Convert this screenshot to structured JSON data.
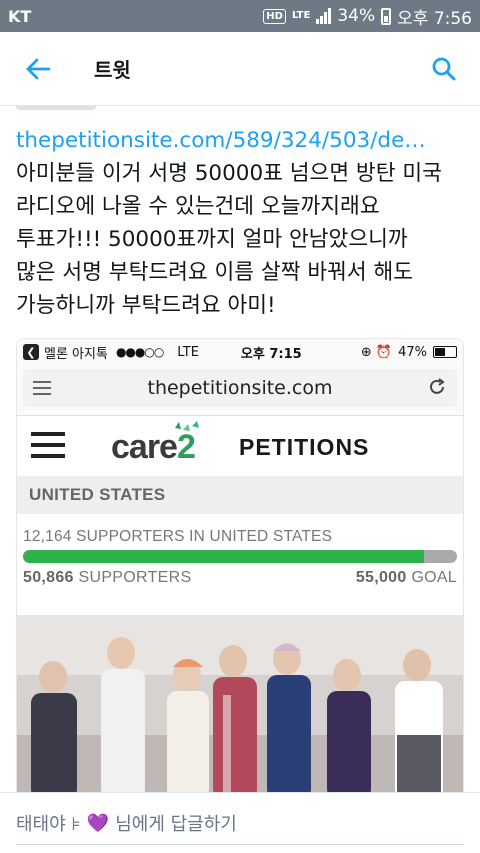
{
  "status_bar": {
    "carrier": "KT",
    "hd": "HD",
    "lte": "LTE",
    "battery": "34%",
    "time": "오후 7:56"
  },
  "app_bar": {
    "title": "트윗",
    "back_icon": "arrow-left-icon",
    "search_icon": "search-icon",
    "accent": "#1da1f2"
  },
  "tweet": {
    "link": "thepetitionsite.com/589/324/503/de…",
    "body": "아미분들 이거 서명 50000표 넘으면 방탄 미국\n라디오에 나올 수 있는건데 오늘까지래요\n투표가!!! 50000표까지 얼마 안남았으니까\n많은 서명 부탁드려요 이름 살짝 바꿔서 해도\n가능하니까 부탁드려요 아미!"
  },
  "embedded": {
    "status": {
      "carrier": "멜론 아지톡",
      "signal_dots": "●●●○○",
      "network": "LTE",
      "time": "오후 7:15",
      "icons": "⊕ ⏰",
      "battery": "47%"
    },
    "address": "thepetitionsite.com",
    "logo": {
      "care": "care",
      "two": "2"
    },
    "petitions": "PETITIONS",
    "country": "UNITED STATES",
    "country_supporters": "12,164 SUPPORTERS IN UNITED STATES",
    "supporters": "50,866",
    "supporters_label": "SUPPORTERS",
    "goal": "55,000",
    "goal_label": "GOAL",
    "progress_fraction": 0.925,
    "colors": {
      "progress": "#2db34a",
      "care2_green": "#2d9d5b"
    }
  },
  "reply": {
    "prefix": "태태야 ⊧",
    "heart_icon": "💜",
    "suffix": "님에게 답글하기"
  }
}
